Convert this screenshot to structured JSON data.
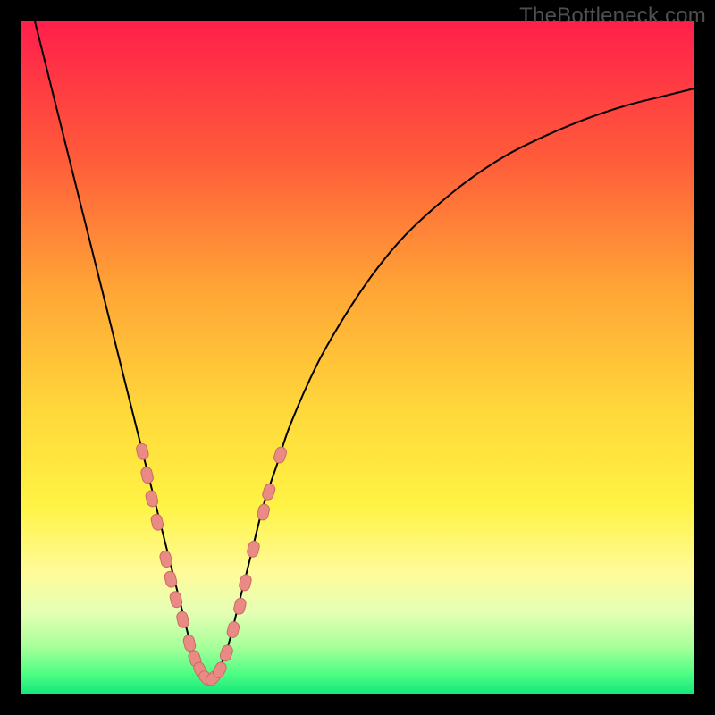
{
  "watermark": "TheBottleneck.com",
  "chart_data": {
    "type": "line",
    "title": "",
    "xlabel": "",
    "ylabel": "",
    "xlim": [
      0,
      100
    ],
    "ylim": [
      0,
      100
    ],
    "background_gradient": {
      "stops": [
        {
          "offset": 0.0,
          "color": "#ff1f4b"
        },
        {
          "offset": 0.2,
          "color": "#ff5a3a"
        },
        {
          "offset": 0.4,
          "color": "#ffa636"
        },
        {
          "offset": 0.58,
          "color": "#ffd83a"
        },
        {
          "offset": 0.72,
          "color": "#fff344"
        },
        {
          "offset": 0.82,
          "color": "#fffb9a"
        },
        {
          "offset": 0.88,
          "color": "#e4ffb4"
        },
        {
          "offset": 0.93,
          "color": "#a8ff9a"
        },
        {
          "offset": 0.97,
          "color": "#4fff84"
        },
        {
          "offset": 1.0,
          "color": "#15e77a"
        }
      ]
    },
    "series": [
      {
        "name": "bottleneck-curve",
        "color": "#000000",
        "x": [
          0,
          2,
          4,
          6,
          8,
          10,
          12,
          14,
          16,
          18,
          20,
          21,
          22,
          23,
          24,
          25,
          26,
          27,
          28,
          29,
          30,
          31,
          32,
          34,
          36,
          38,
          40,
          44,
          48,
          52,
          56,
          60,
          66,
          72,
          78,
          84,
          90,
          96,
          100
        ],
        "y": [
          108,
          100,
          92,
          84,
          76,
          68,
          60,
          52,
          44,
          36,
          28,
          24,
          20,
          16,
          12,
          8,
          5,
          3,
          2,
          3,
          5,
          8,
          12,
          20,
          28,
          34,
          40,
          49,
          56,
          62,
          67,
          71,
          76,
          80,
          83,
          85.5,
          87.5,
          89,
          90
        ]
      }
    ],
    "markers": {
      "name": "sample-points",
      "shape": "capsule",
      "color": "#e98a84",
      "stroke": "#c96b64",
      "points": [
        {
          "x": 18.0,
          "y": 36.0
        },
        {
          "x": 18.7,
          "y": 32.5
        },
        {
          "x": 19.4,
          "y": 29.0
        },
        {
          "x": 20.2,
          "y": 25.5
        },
        {
          "x": 21.5,
          "y": 20.0
        },
        {
          "x": 22.2,
          "y": 17.0
        },
        {
          "x": 23.0,
          "y": 14.0
        },
        {
          "x": 24.0,
          "y": 11.0
        },
        {
          "x": 25.0,
          "y": 7.5
        },
        {
          "x": 25.8,
          "y": 5.2
        },
        {
          "x": 26.6,
          "y": 3.5
        },
        {
          "x": 27.5,
          "y": 2.3
        },
        {
          "x": 28.5,
          "y": 2.3
        },
        {
          "x": 29.5,
          "y": 3.5
        },
        {
          "x": 30.5,
          "y": 6.0
        },
        {
          "x": 31.5,
          "y": 9.5
        },
        {
          "x": 32.5,
          "y": 13.0
        },
        {
          "x": 33.3,
          "y": 16.5
        },
        {
          "x": 34.5,
          "y": 21.5
        },
        {
          "x": 36.0,
          "y": 27.0
        },
        {
          "x": 36.8,
          "y": 30.0
        },
        {
          "x": 38.5,
          "y": 35.5
        }
      ]
    }
  }
}
